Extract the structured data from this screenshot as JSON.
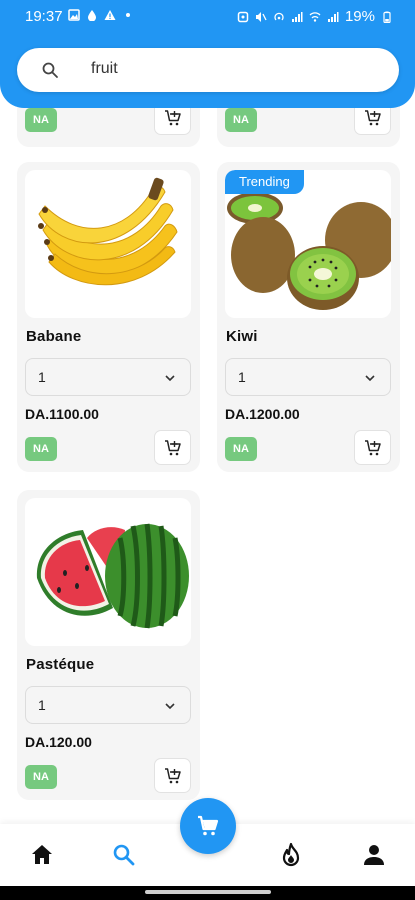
{
  "status_bar": {
    "time": "19:37",
    "battery": "19%",
    "left_icons": [
      "image-icon",
      "drop-icon",
      "warning-icon",
      "dot-icon"
    ],
    "right_icons": [
      "alarm-icon",
      "mute-icon",
      "hotspot-icon",
      "signal-icon",
      "wifi-icon",
      "signal-icon",
      "battery-icon"
    ]
  },
  "search": {
    "value": "fruit",
    "icon": "search-icon"
  },
  "products": [
    {
      "name": "Babane",
      "quantity": "1",
      "price": "DA.1100.00",
      "badge": "NA",
      "image": "bananas-image"
    },
    {
      "name": "Kiwi",
      "quantity": "1",
      "price": "DA.1200.00",
      "badge": "NA",
      "tag": "Trending",
      "image": "kiwi-image"
    },
    {
      "name": "Pastéque",
      "quantity": "1",
      "price": "DA.120.00",
      "badge": "NA",
      "image": "watermelon-image"
    }
  ],
  "partial_row": {
    "left_badge": "NA",
    "right_badge": "NA"
  },
  "bottom_nav": {
    "items": [
      "home-icon",
      "search-icon",
      "fire-icon",
      "person-icon"
    ],
    "active": "search-icon",
    "fab_icon": "cart-icon"
  },
  "colors": {
    "primary": "#2196f3",
    "badge_green": "#76c97f",
    "card_bg": "#f5f5f5"
  }
}
